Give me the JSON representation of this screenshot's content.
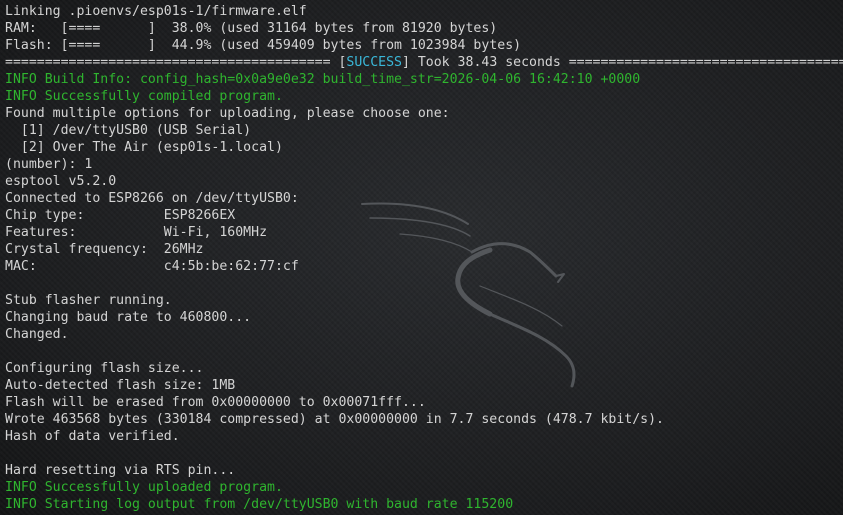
{
  "theme": {
    "text_color": "#d4d4d4",
    "info_color": "#2fb52f",
    "success_color": "#3ab7d8",
    "background": "#1c1d1f"
  },
  "background_logo": {
    "icon": "kali-dragon-icon"
  },
  "lines": [
    {
      "type": "plain",
      "text": "Linking .pioenvs/esp01s-1/firmware.elf"
    },
    {
      "type": "plain",
      "text": "RAM:   [====      ]  38.0% (used 31164 bytes from 81920 bytes)"
    },
    {
      "type": "plain",
      "text": "Flash: [====      ]  44.9% (used 459409 bytes from 1023984 bytes)"
    },
    {
      "type": "success",
      "before": "========================================= [",
      "status": "SUCCESS",
      "after": "] Took 38.43 seconds =========================================="
    },
    {
      "type": "info",
      "text": "INFO Build Info: config_hash=0x0a9e0e32 build_time_str=2026-04-06 16:42:10 +0000"
    },
    {
      "type": "info",
      "text": "INFO Successfully compiled program."
    },
    {
      "type": "plain",
      "text": "Found multiple options for uploading, please choose one:"
    },
    {
      "type": "plain",
      "text": "  [1] /dev/ttyUSB0 (USB Serial)"
    },
    {
      "type": "plain",
      "text": "  [2] Over The Air (esp01s-1.local)"
    },
    {
      "type": "plain",
      "text": "(number): 1"
    },
    {
      "type": "plain",
      "text": "esptool v5.2.0"
    },
    {
      "type": "plain",
      "text": "Connected to ESP8266 on /dev/ttyUSB0:"
    },
    {
      "type": "plain",
      "text": "Chip type:          ESP8266EX"
    },
    {
      "type": "plain",
      "text": "Features:           Wi-Fi, 160MHz"
    },
    {
      "type": "plain",
      "text": "Crystal frequency:  26MHz"
    },
    {
      "type": "plain",
      "text": "MAC:                c4:5b:be:62:77:cf"
    },
    {
      "type": "plain",
      "text": ""
    },
    {
      "type": "plain",
      "text": "Stub flasher running."
    },
    {
      "type": "plain",
      "text": "Changing baud rate to 460800..."
    },
    {
      "type": "plain",
      "text": "Changed."
    },
    {
      "type": "plain",
      "text": ""
    },
    {
      "type": "plain",
      "text": "Configuring flash size..."
    },
    {
      "type": "plain",
      "text": "Auto-detected flash size: 1MB"
    },
    {
      "type": "plain",
      "text": "Flash will be erased from 0x00000000 to 0x00071fff..."
    },
    {
      "type": "plain",
      "text": "Wrote 463568 bytes (330184 compressed) at 0x00000000 in 7.7 seconds (478.7 kbit/s)."
    },
    {
      "type": "plain",
      "text": "Hash of data verified."
    },
    {
      "type": "plain",
      "text": ""
    },
    {
      "type": "plain",
      "text": "Hard resetting via RTS pin..."
    },
    {
      "type": "info",
      "text": "INFO Successfully uploaded program."
    },
    {
      "type": "info",
      "text": "INFO Starting log output from /dev/ttyUSB0 with baud rate 115200"
    }
  ]
}
